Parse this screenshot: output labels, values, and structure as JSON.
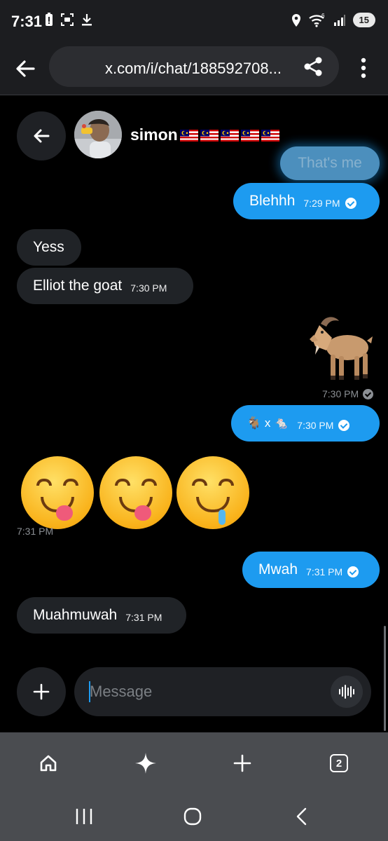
{
  "status_bar": {
    "time": "7:31",
    "battery": "15",
    "network_label": "6"
  },
  "browser": {
    "url": "x.com/i/chat/188592708...",
    "tab_count": "2"
  },
  "chat": {
    "contact_name": "simon",
    "flags_count": 5,
    "ghost_message": "That's me",
    "messages": [
      {
        "id": "m1",
        "direction": "out",
        "text": "Blehhh",
        "time": "7:29 PM"
      },
      {
        "id": "m2",
        "direction": "in",
        "text": "Yess",
        "time": ""
      },
      {
        "id": "m3",
        "direction": "in",
        "text": "Elliot the goat",
        "time": "7:30 PM"
      },
      {
        "id": "m4",
        "direction": "out",
        "text": "🐐",
        "time": "7:30 PM",
        "kind": "emoji-only"
      },
      {
        "id": "m5",
        "direction": "out",
        "text": "🐐 x 🐁",
        "time": "7:30 PM"
      },
      {
        "id": "m6",
        "direction": "in",
        "text": "😋😋🤤",
        "time": "7:31 PM",
        "kind": "emoji-only"
      },
      {
        "id": "m7",
        "direction": "out",
        "text": "Mwah",
        "time": "7:31 PM"
      },
      {
        "id": "m8",
        "direction": "in",
        "text": "Muahmuwah",
        "time": "7:31 PM"
      }
    ],
    "composer_placeholder": "Message"
  },
  "colors": {
    "accent": "#1d9bf0",
    "incoming_bubble": "#202327",
    "background": "#000000",
    "toolbar": "#1c1d20",
    "bottom_nav": "#4a4c50"
  },
  "icons": [
    "back-arrow-icon",
    "share-icon",
    "more-vert-icon",
    "plus-icon",
    "voice-wave-icon",
    "home-icon",
    "sparkle-icon",
    "new-tab-icon",
    "tab-switcher-icon",
    "recents-icon",
    "home-circle-icon",
    "system-back-icon"
  ]
}
